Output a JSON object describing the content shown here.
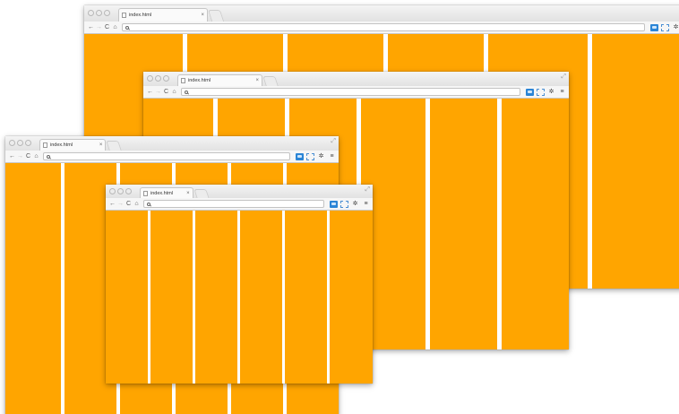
{
  "tab_title": "index.html",
  "close_glyph": "×",
  "resize_glyph": "⤢",
  "nav": {
    "back": "←",
    "forward": "→",
    "reload": "C",
    "home": "⌂"
  },
  "menu_glyph": "≡",
  "settings_glyph": "✲",
  "colors": {
    "page_background": "#ffa500",
    "column_gutter": "#ffffff",
    "extension_blue": "#2b85d6"
  },
  "icons": [
    "page-icon",
    "back-arrow-icon",
    "forward-arrow-icon",
    "reload-icon",
    "home-icon",
    "search-icon",
    "responsive-extension-icon",
    "frame-extension-icon",
    "settings-icon",
    "menu-icon",
    "resize-icon"
  ],
  "windows": [
    {
      "name": "browser-window-xl",
      "content_columns": 6
    },
    {
      "name": "browser-window-lg",
      "content_columns": 6
    },
    {
      "name": "browser-window-md",
      "content_columns": 6
    },
    {
      "name": "browser-window-sm",
      "content_columns": 6
    }
  ]
}
